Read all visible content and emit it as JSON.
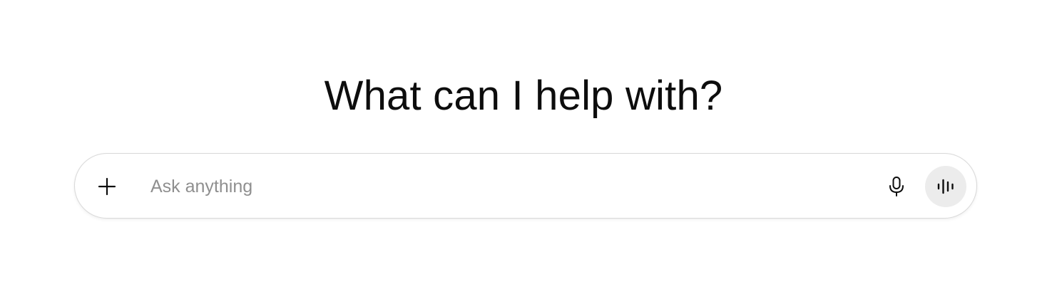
{
  "main": {
    "heading": "What can I help with?"
  },
  "composer": {
    "placeholder": "Ask anything",
    "icons": {
      "add": "plus-icon",
      "dictate": "microphone-icon",
      "voice_mode": "voice-waveform-icon"
    },
    "colors": {
      "text": "#0d0d0d",
      "placeholder": "#8f8f8f",
      "border": "#d9d9d9",
      "voice_button_bg": "#ececec"
    }
  }
}
